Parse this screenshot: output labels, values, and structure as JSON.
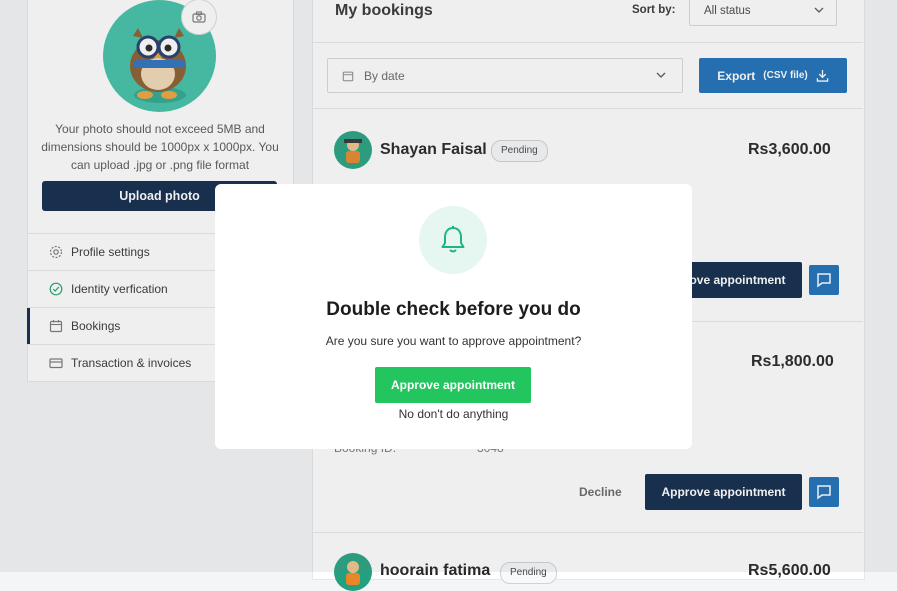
{
  "sidebar": {
    "photo_note": "Your photo should not exceed 5MB and dimensions should be 1000px x 1000px. You can upload .jpg or .png file format",
    "upload_label": "Upload photo",
    "items": [
      {
        "label": "Profile settings",
        "icon": "gear-icon"
      },
      {
        "label": "Identity verfication",
        "icon": "check-circle-icon"
      },
      {
        "label": "Bookings",
        "icon": "calendar-icon"
      },
      {
        "label": "Transaction & invoices",
        "icon": "card-icon"
      }
    ]
  },
  "main": {
    "title": "My bookings",
    "sort_label": "Sort by:",
    "sort_value": "All status",
    "date_filter": "By date",
    "export_label": "Export",
    "export_sub": "(CSV file)",
    "bookings": [
      {
        "name": "Shayan Faisal",
        "status": "Pending",
        "price": "Rs3,600.00",
        "approve": "Approve appointment"
      },
      {
        "price": "Rs1,800.00",
        "meta_label": "Booking ID:",
        "meta_value": "3048",
        "decline": "Decline",
        "approve": "Approve appointment"
      },
      {
        "name": "hoorain fatima",
        "status": "Pending",
        "price": "Rs5,600.00"
      }
    ]
  },
  "modal": {
    "title": "Double check before you do",
    "subtitle": "Are you sure you want to approve appointment?",
    "approve_label": "Approve appointment",
    "cancel_label": "No don't do anything"
  },
  "colors": {
    "primary": "#0b2547",
    "accent_blue": "#1a6eb8",
    "success": "#22c55e",
    "teal": "#3fc0a7"
  }
}
